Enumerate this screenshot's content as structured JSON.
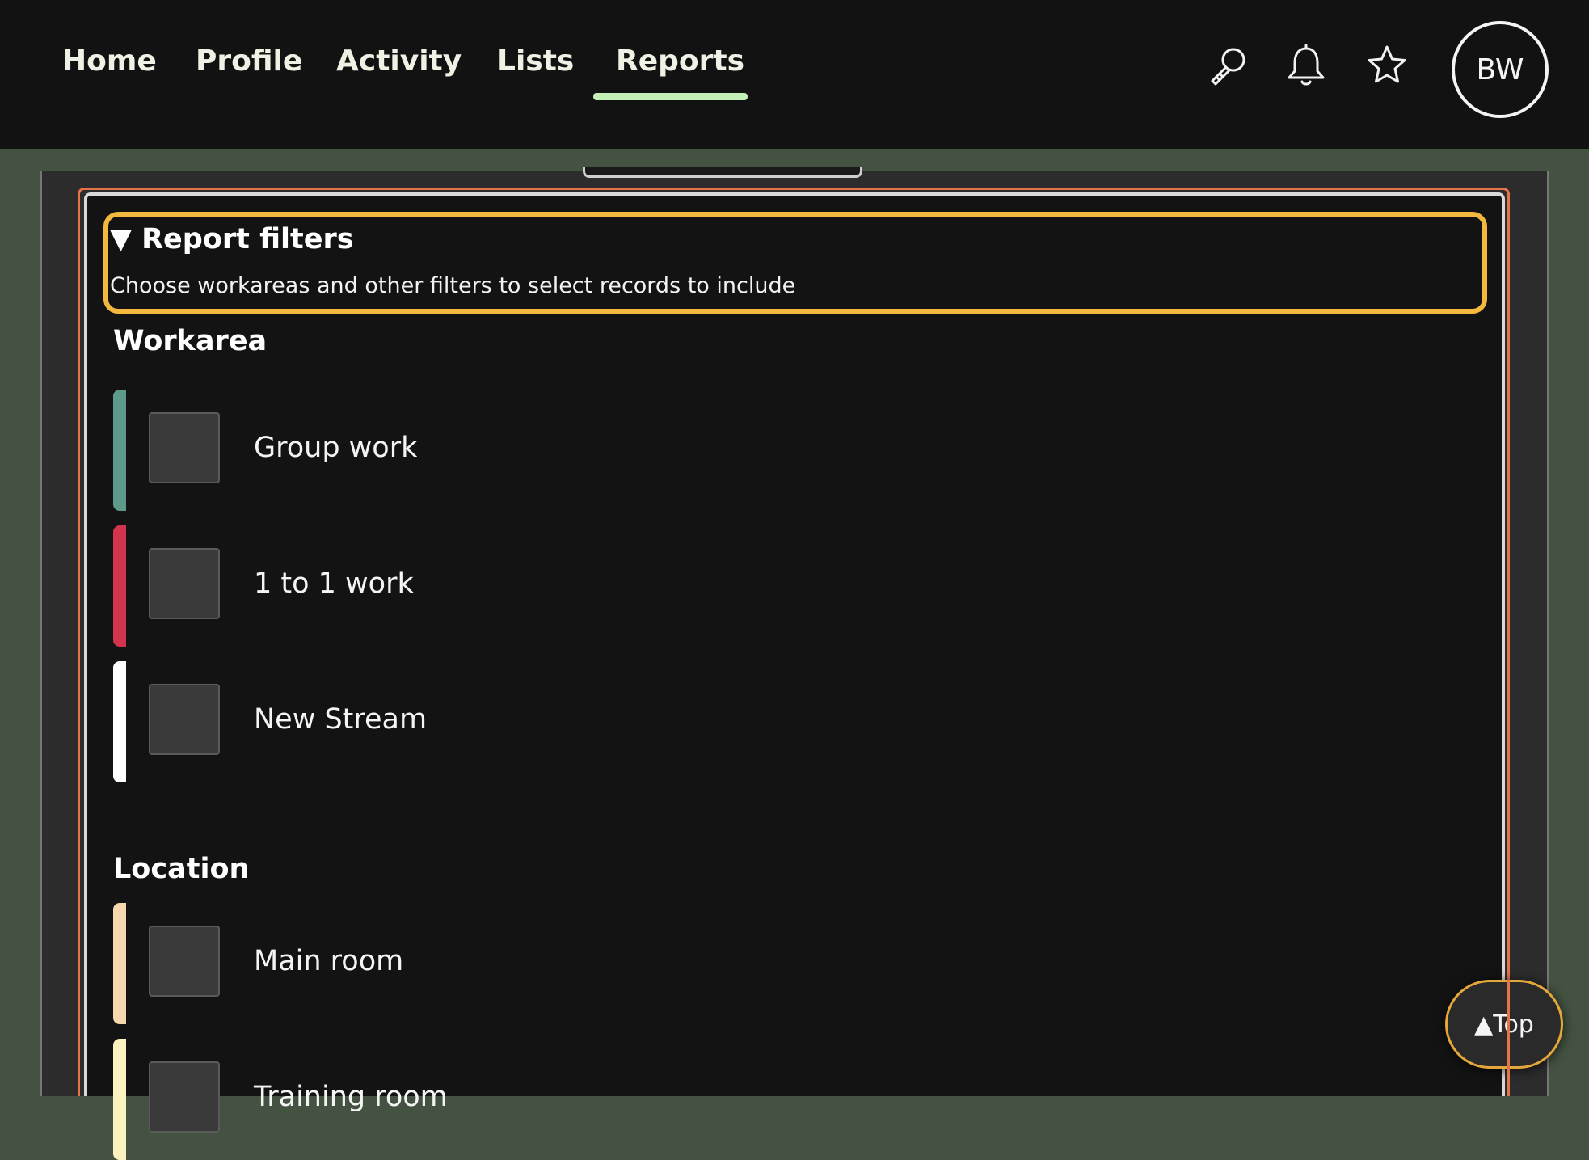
{
  "nav": {
    "links": [
      {
        "label": "Home"
      },
      {
        "label": "Profile"
      },
      {
        "label": "Activity"
      },
      {
        "label": "Lists"
      },
      {
        "label": "Reports",
        "active": true
      }
    ],
    "active_underline_color": "#c3f0b6",
    "icons": [
      "search-icon",
      "bell-icon",
      "star-icon"
    ],
    "avatar_initials": "BW"
  },
  "filters": {
    "summary_title": "▼ Report filters",
    "summary_description": "Choose workareas and other filters to select records to include",
    "highlight_color": "#f3b93e",
    "outline_color": "#e8734a",
    "workarea": {
      "heading": "Workarea",
      "options": [
        {
          "label": "Group work",
          "color": "#5d9a8c",
          "checked": false
        },
        {
          "label": "1 to 1 work",
          "color": "#d2344f",
          "checked": false
        },
        {
          "label": "New Stream",
          "color": "#ffffff",
          "checked": false
        }
      ]
    },
    "location": {
      "heading": "Location",
      "options": [
        {
          "label": "Main room",
          "color": "#f7d7ad",
          "checked": false
        },
        {
          "label": "Training room",
          "color": "#fbf2c0",
          "checked": false
        }
      ]
    }
  },
  "top_button": {
    "label": "▲Top"
  }
}
